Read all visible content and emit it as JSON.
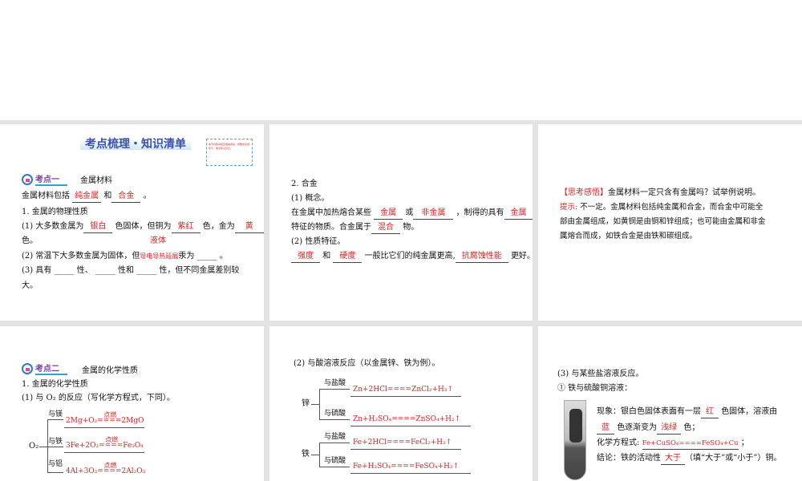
{
  "p1": {
    "title": "考点梳理・知识清单",
    "note": "本节内容请结合课本阅读，按要求完成学习，重点知识记忆。",
    "tag": "考点一",
    "heading": "金属材料",
    "l1a": "金属材料包括",
    "l1b": "纯金属",
    "l1c": "和",
    "l1d": "合金",
    "l1e": "。",
    "l2": "1. 金属的物理性质",
    "l3a": "(1) 大多数金属为",
    "l3b": "银白",
    "l3c": "色固体，但铜为",
    "l3d": "紫红",
    "l3e": "色，金为",
    "l3f": "黄",
    "l4a": "色。",
    "l4b": "液体",
    "l5a": "(2) 常温下大多数金属为固体，但",
    "l5b": "导电",
    "l5c": "导热",
    "l5d": "延展",
    "l5e": "汞为",
    "l5f": "。",
    "l6": "(3) 具有 _____ 性、 _____ 性和 _____ 性，但不同金属差别较",
    "l7": "大。"
  },
  "p2": {
    "l1": "2. 合金",
    "l2": "(1) 概念。",
    "l3a": "在金属中加热熔合某些",
    "l3b": "金属",
    "l3c": "或",
    "l3d": "非金属",
    "l3e": "，制得的具有",
    "l3f": "金属",
    "l4a": "特征的物质。合金属于",
    "l4b": "混合",
    "l4c": "物。",
    "l5": "(2) 性质特征。",
    "l6a": "强度",
    "l6b": "和",
    "l6c": "硬度",
    "l6d": "一般比它们的纯金属更高,",
    "l6e": "抗腐蚀性能",
    "l6f": "更好。"
  },
  "p3": {
    "a": "【思考感悟】",
    "b": "金属材料一定只含有金属吗？试举例说明。",
    "c": "提示:",
    "d": "不一定。金属材料包括纯金属和合金，而合金中可能全",
    "e": "部由金属组成，如黄铜是由铜和锌组成；也可能由金属和非金",
    "f": "属熔合而成，如铁合金是由铁和碳组成。"
  },
  "p4": {
    "tag": "考点二",
    "heading": "金属的化学性质",
    "l1": "1. 金属的化学性质",
    "l2": "(1) 与 O₂ 的反应（写化学方程式，下同）。",
    "o2": "O₂",
    "b1": "与镁",
    "b2": "与铁",
    "b3": "与铝",
    "cond": "点燃",
    "e1a": "2Mg+O₂",
    "e1b": "2MgO",
    "e2a": "3Fe+2O₂",
    "e2b": "Fe₃O₄",
    "e3a": "4Al+3O₂",
    "e3b": "2Al₂O₃",
    "eqs": "===="
  },
  "p5": {
    "l1": "(2) 与酸溶液反应（以金属锌、铁为例）。",
    "zn": "锌",
    "fe": "铁",
    "hcl": "与盐酸",
    "h2so4": "与硫酸",
    "e1": "Zn+2HCl====ZnCl₂+H₂↑",
    "e2": "Zn+H₂SO₄====ZnSO₄+H₂↑",
    "e3": "Fe+2HCl====FeCl₂+H₂↑",
    "e4": "Fe+H₂SO₄====FeSO₄+H₂↑"
  },
  "p6": {
    "l1": "(3) 与某些盐溶液反应。",
    "l2": "① 铁与硫酸铜溶液：",
    "a1": "现象：银白色固体表面有一层",
    "a2": "红",
    "a3": "色固体，溶液由",
    "b1": "蓝",
    "b2": "色逐渐变为",
    "b3": "浅绿",
    "b4": "色；",
    "c1": "化学方程式:",
    "c2": "Fe+CuSO₄====FeSO₄+Cu",
    "c3": "；",
    "d1": "结论：铁的活动性",
    "d2": "大于",
    "d3": "（填“大于”或“小于”）铜。"
  }
}
